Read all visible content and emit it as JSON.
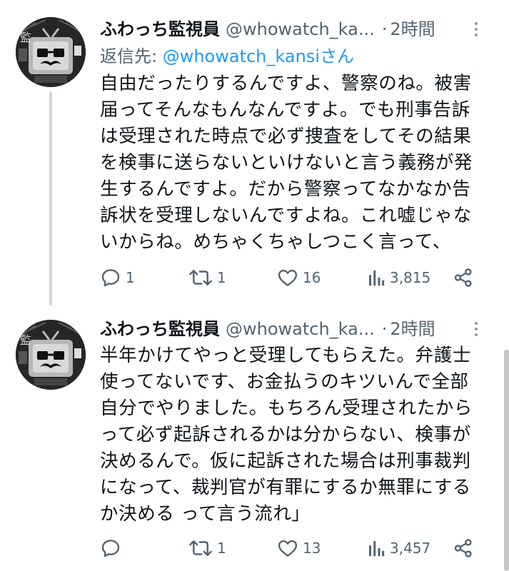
{
  "tweets": [
    {
      "name": "ふわっち監視員",
      "handle": "@whowatch_ka...",
      "dot": "·",
      "time": "2時間",
      "reply_prefix": "返信先: ",
      "reply_mention": "@whowatch_kansiさん",
      "body": "自由だったりするんですよ、警察のね。被害\n届ってそんなもんなんですよ。でも刑事告訴\nは受理された時点で必ず捜査をしてその結果\nを検事に送らないといけないと言う義務が発\n生するんですよ。だから警察ってなかなか告\n訴状を受理しないんですよね。これ嘘じゃな\nいからね。めちゃくちゃしつこく言って、",
      "replies": "1",
      "retweets": "1",
      "likes": "16",
      "views": "3,815"
    },
    {
      "name": "ふわっち監視員",
      "handle": "@whowatch_ka...",
      "dot": "·",
      "time": "2時間",
      "body": "半年かけてやっと受理してもらえた。弁護士\n使ってないです、お金払うのキツいんで全部\n自分でやりました。もちろん受理されたから\nって必ず起訴されるかは分からない、検事が\n決めるんで。仮に起訴された場合は刑事裁判\nになって、裁判官が有罪にするか無罪にする\nか決める って言う流れ」",
      "replies": "",
      "retweets": "1",
      "likes": "13",
      "views": "3,457"
    }
  ],
  "colors": {
    "text": "#0f1419",
    "secondary": "#536471",
    "accent": "#1d9bf0",
    "thread_line": "#cfd9de"
  },
  "icons": [
    "reply-icon",
    "retweet-icon",
    "like-icon",
    "views-icon",
    "share-icon",
    "more-icon"
  ]
}
